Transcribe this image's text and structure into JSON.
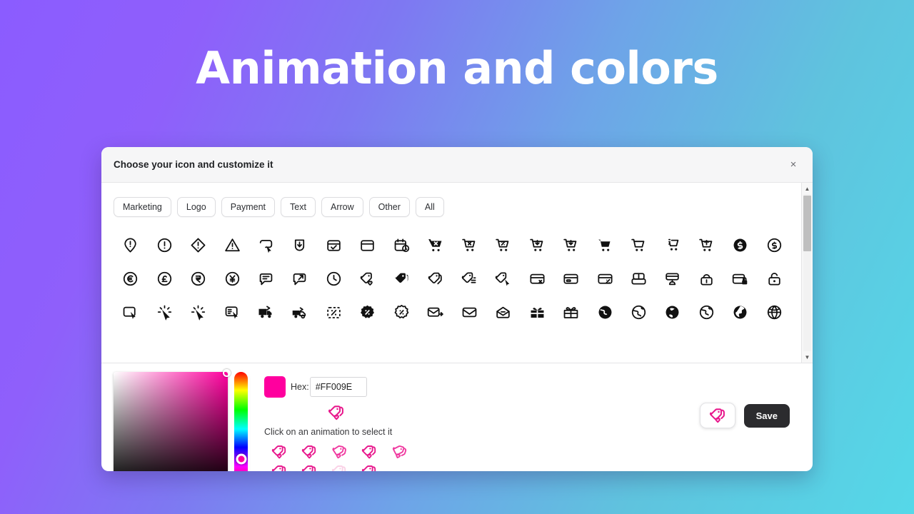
{
  "hero": {
    "title": "Animation and colors"
  },
  "theme": {
    "bg_gradient_start": "#8B5CFF",
    "bg_gradient_end": "#55D8E8",
    "accent": "#FF009E",
    "save_bg": "#2B2B2E"
  },
  "modal": {
    "title": "Choose your icon and customize it",
    "close_label": "×"
  },
  "categories": [
    {
      "label": "Marketing"
    },
    {
      "label": "Logo"
    },
    {
      "label": "Payment"
    },
    {
      "label": "Text"
    },
    {
      "label": "Arrow"
    },
    {
      "label": "Other"
    },
    {
      "label": "All"
    }
  ],
  "icon_grid": {
    "rows": 3,
    "columns": 20,
    "icons": [
      "alert-pin-icon",
      "alert-circle-icon",
      "alert-diamond-icon",
      "alert-triangle-icon",
      "cursor-tag-icon",
      "hand-click-icon",
      "calendar-check-icon",
      "calendar-icon",
      "calendar-clock-icon",
      "cart-x-filled-icon",
      "cart-x-icon",
      "cart-percent-icon",
      "cart-down-icon",
      "cart-arrow-down-icon",
      "cart-filled-icon",
      "cart-empty-icon",
      "cart-list-icon",
      "cart-up-icon",
      "coin-dollar-filled-icon",
      "coin-dollar-icon",
      "coin-euro-icon",
      "coin-pound-icon",
      "coin-rupee-icon",
      "coin-yen-icon",
      "chat-lines-icon",
      "chat-share-icon",
      "clock-icon",
      "tag-heart-icon",
      "tag-filled-icon",
      "tag-outline-icon",
      "tag-lines-icon",
      "tag-cursor-icon",
      "card-x-icon",
      "card-icon",
      "card-percent-icon",
      "card-reader-icon",
      "card-terminal-icon",
      "lock-wifi-icon",
      "card-lock-icon",
      "lock-open-icon",
      "screen-cursor-icon",
      "cursor-click-icon",
      "cursor-click-alt-icon",
      "window-cursor-icon",
      "truck-filled-icon",
      "truck-icon",
      "discount-dashed-icon",
      "discount-badge-filled-icon",
      "discount-badge-icon",
      "mail-send-icon",
      "mail-icon",
      "mail-minus-icon",
      "gift-filled-icon",
      "gift-icon",
      "globe-filled-icon",
      "globe-icon",
      "globe-dark-icon",
      "globe-outline-icon",
      "globe-world-icon",
      "globe-grid-icon"
    ]
  },
  "color_picker": {
    "hex_label": "Hex:",
    "hex_value": "#FF009E",
    "swatch_color": "#FF009E"
  },
  "animation": {
    "hint": "Click on an animation to select it",
    "preview_name": "tag-heart-icon",
    "options": [
      {
        "name": "anim-bounce",
        "color": "#E8188C",
        "opacity": 1,
        "rotate": 0
      },
      {
        "name": "anim-pulse",
        "color": "#E8188C",
        "opacity": 1,
        "rotate": 0
      },
      {
        "name": "anim-flip",
        "color": "#F03AA0",
        "opacity": 1,
        "rotate": 12
      },
      {
        "name": "anim-shake",
        "color": "#E8188C",
        "opacity": 1,
        "rotate": 0
      },
      {
        "name": "anim-swing",
        "color": "#F03AA0",
        "opacity": 1,
        "rotate": 18
      },
      {
        "name": "anim-wobble",
        "color": "#E8188C",
        "opacity": 1,
        "rotate": 0
      },
      {
        "name": "anim-tada",
        "color": "#E8188C",
        "opacity": 1,
        "rotate": 0
      },
      {
        "name": "anim-fade",
        "color": "#F59BC8",
        "opacity": 0.45,
        "rotate": 0
      },
      {
        "name": "anim-jello",
        "color": "#E8188C",
        "opacity": 1,
        "rotate": 0
      }
    ]
  },
  "actions": {
    "preview_name": "tag-heart-icon",
    "save_label": "Save"
  },
  "scrollbar": {
    "up_arrow": "▲",
    "down_arrow": "▼"
  }
}
